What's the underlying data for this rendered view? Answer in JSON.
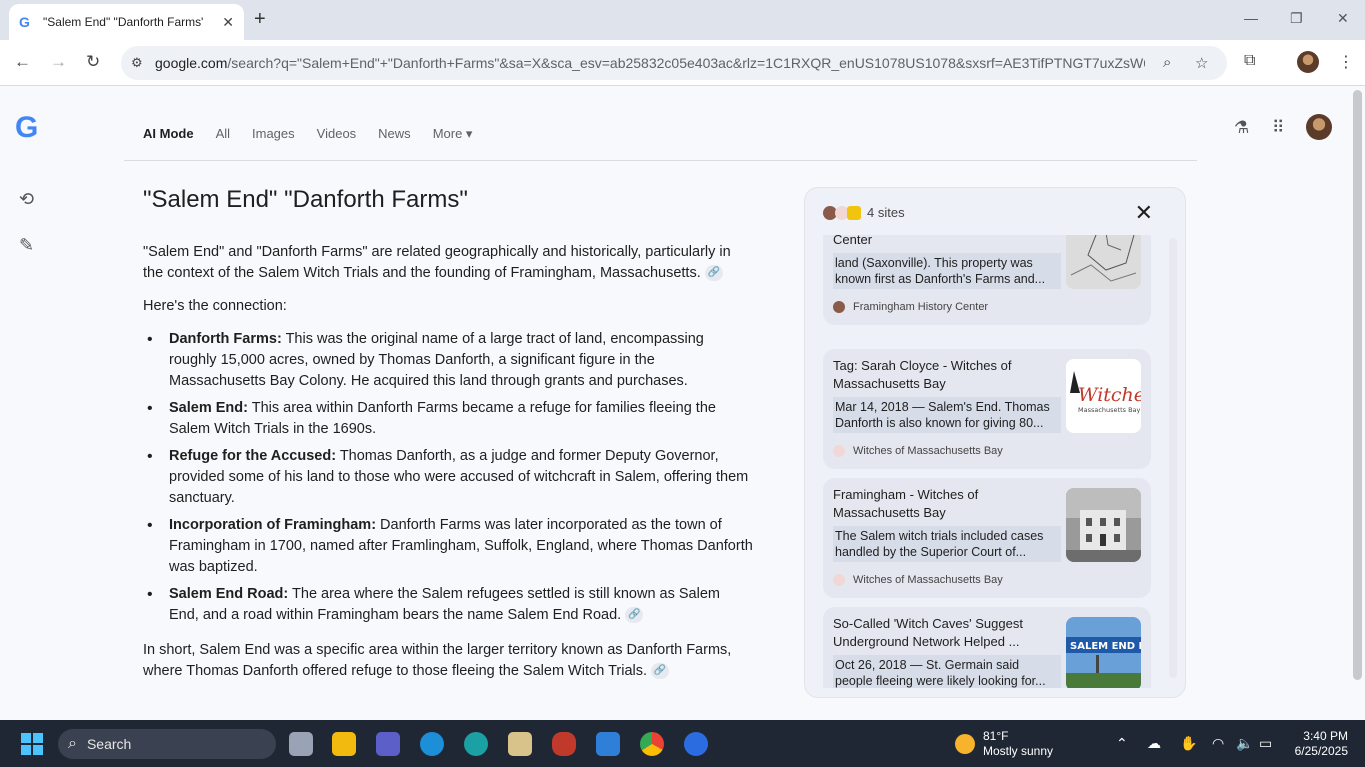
{
  "browser": {
    "tab_title": "\"Salem End\" \"Danforth Farms\" -",
    "url_host": "google.com",
    "url_path": "/search?q=\"Salem+End\"+\"Danforth+Farms\"&sa=X&sca_esv=ab25832c05e403ac&rlz=1C1RXQR_enUS1078US1078&sxsrf=AE3TifPTNGT7uxZsW6X..."
  },
  "search_tabs": [
    "AI Mode",
    "All",
    "Images",
    "Videos",
    "News",
    "More"
  ],
  "answer": {
    "title": "\"Salem End\" \"Danforth Farms\"",
    "intro": "\"Salem End\" and \"Danforth Farms\" are related geographically and historically, particularly in the context of the Salem Witch Trials and the founding of Framingham, Massachusetts.",
    "connection_lead": "Here's the connection:",
    "bullets": [
      {
        "term": "Danforth Farms:",
        "text": " This was the original name of a large tract of land, encompassing roughly 15,000 acres, owned by Thomas Danforth, a significant figure in the Massachusetts Bay Colony. He acquired this land through grants and purchases."
      },
      {
        "term": "Salem End:",
        "text": " This area within Danforth Farms became a refuge for families fleeing the Salem Witch Trials in the 1690s."
      },
      {
        "term": "Refuge for the Accused:",
        "text": " Thomas Danforth, as a judge and former Deputy Governor, provided some of his land to those who were accused of witchcraft in Salem, offering them sanctuary."
      },
      {
        "term": "Incorporation of Framingham:",
        "text": " Danforth Farms was later incorporated as the town of Framingham in 1700, named after Framlingham, Suffolk, England, where Thomas Danforth was baptized."
      },
      {
        "term": "Salem End Road:",
        "text": " The area where the Salem refugees settled is still known as Salem End, and a road within Framingham bears the name Salem End Road."
      }
    ],
    "summary": "In short, Salem End was a specific area within the larger territory known as Danforth Farms, where Thomas Danforth offered refuge to those fleeing the Salem Witch Trials."
  },
  "sources": {
    "count_label": "4 sites",
    "cards": [
      {
        "title": "Danforth's Farms - Framingham History Center",
        "snippet": "land (Saxonville). This property was known first as Danforth's Farms and...",
        "source": "Framingham History Center"
      },
      {
        "title": "Tag: Sarah Cloyce - Witches of Massachusetts Bay",
        "snippet": "Mar 14, 2018 — Salem's End. Thomas Danforth is also known for giving 80...",
        "source": "Witches of Massachusetts Bay"
      },
      {
        "title": "Framingham - Witches of Massachusetts Bay",
        "snippet": "The Salem witch trials included cases handled by the Superior Court of...",
        "source": "Witches of Massachusetts Bay"
      },
      {
        "title": "So-Called 'Witch Caves' Suggest Underground Network Helped ...",
        "snippet": "Oct 26, 2018 — St. Germain said people fleeing were likely looking for...",
        "source": ""
      }
    ],
    "thumb_texts": {
      "witches_logo": "Witches",
      "witches_sub": "Massachusetts Bay",
      "sign": "SALEM END R"
    }
  },
  "taskbar": {
    "search_placeholder": "Search",
    "weather_temp": "81°F",
    "weather_desc": "Mostly sunny",
    "time": "3:40 PM",
    "date": "6/25/2025"
  },
  "colors": {
    "accent": "#4285f4",
    "taskbar": "#1f2735"
  }
}
